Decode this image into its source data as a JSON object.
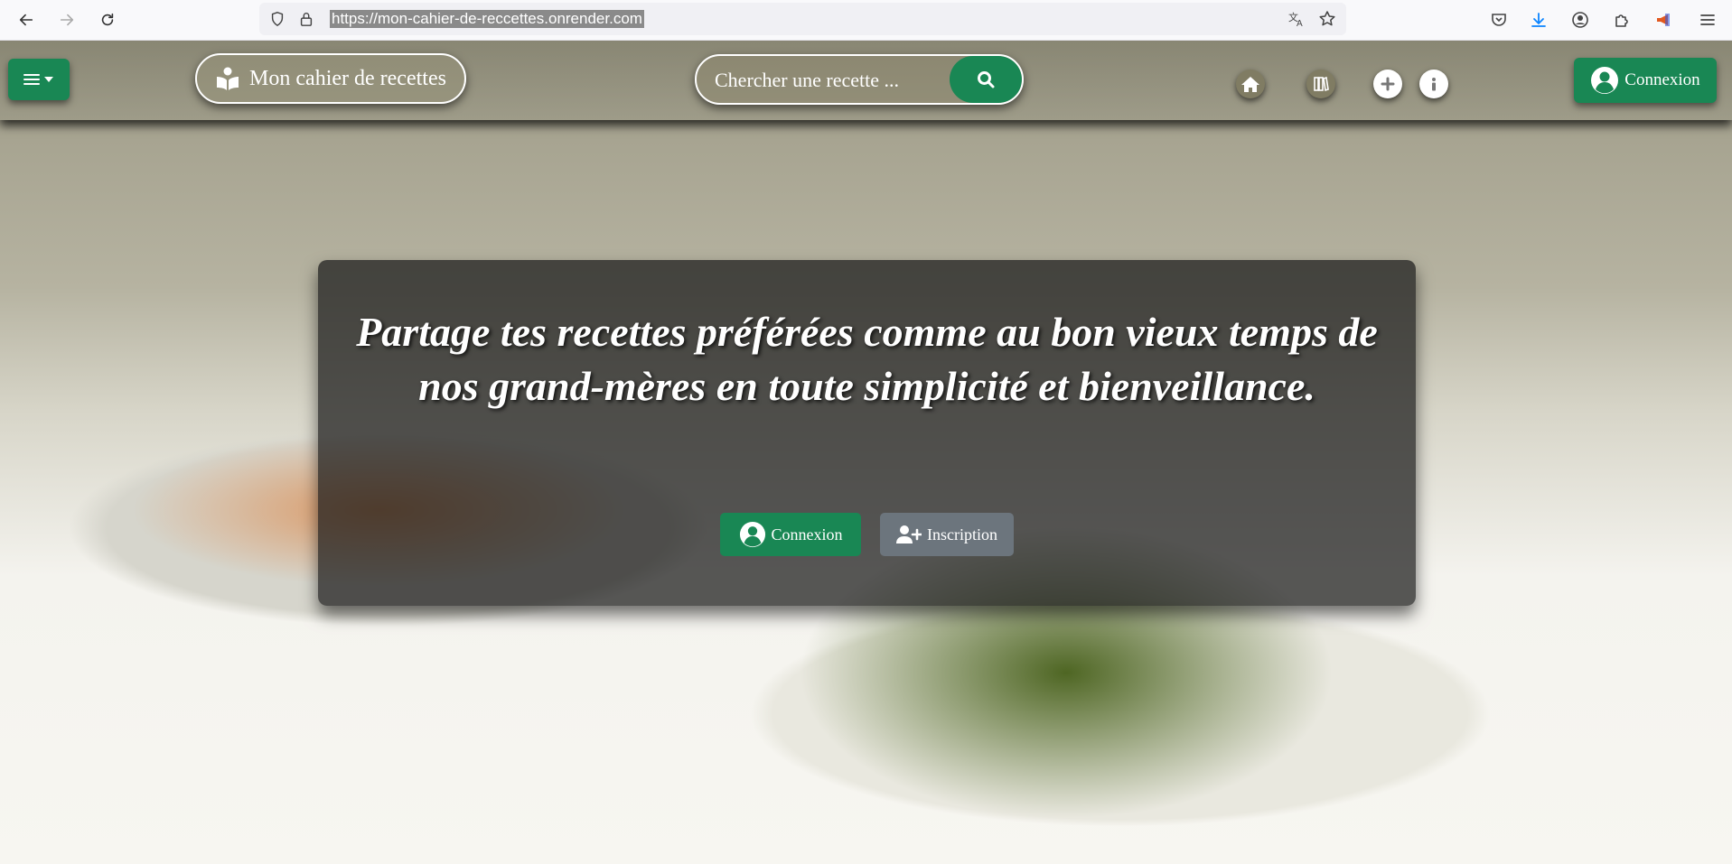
{
  "browser": {
    "url": "https://mon-cahier-de-reccettes.onrender.com"
  },
  "navbar": {
    "brand": "Mon cahier de recettes",
    "search_placeholder": "Chercher une recette ...",
    "login_label": "Connexion",
    "icons": [
      "menu-icon",
      "book-reader-icon",
      "search-icon",
      "home-icon",
      "books-icon",
      "plus-icon",
      "info-icon",
      "user-circle-icon"
    ]
  },
  "hero": {
    "title": "Partage tes recettes préférées comme au bon vieux temps de nos grand-mères en toute simplicité et bienveillance.",
    "login_label": "Connexion",
    "signup_label": "Inscription"
  },
  "colors": {
    "primary": "#198754",
    "secondary": "#6c757d",
    "card_bg": "#191919"
  }
}
